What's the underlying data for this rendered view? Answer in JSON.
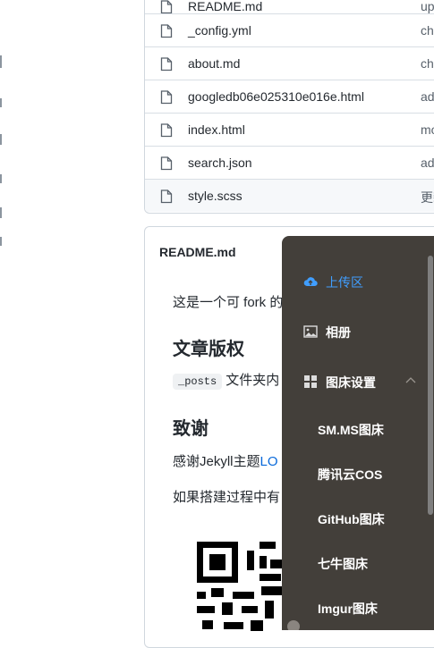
{
  "files": [
    {
      "name": "README.md",
      "message": "upd"
    },
    {
      "name": "_config.yml",
      "message": "ch"
    },
    {
      "name": "about.md",
      "message": "ch"
    },
    {
      "name": "googledb06e025310e016e.html",
      "message": "ad"
    },
    {
      "name": "index.html",
      "message": "mo"
    },
    {
      "name": "search.json",
      "message": "ad"
    },
    {
      "name": "style.scss",
      "message": "更新"
    }
  ],
  "readme": {
    "header": "README.md",
    "intro": "这是一个可 fork 的",
    "copyright_heading": "文章版权",
    "posts_code": "_posts",
    "posts_text": "文件夹内",
    "thanks_heading": "致谢",
    "thanks_text": "感谢Jekyll主题",
    "thanks_link": "LO",
    "help_text": "如果搭建过程中有"
  },
  "menu": {
    "upload": "上传区",
    "album": "相册",
    "settings": "图床设置",
    "sub": [
      "SM.MS图床",
      "腾讯云COS",
      "GitHub图床",
      "七牛图床",
      "Imgur图床"
    ]
  },
  "colors": {
    "menu_bg": "#433f3a",
    "active": "#409eff",
    "link": "#0969da"
  }
}
